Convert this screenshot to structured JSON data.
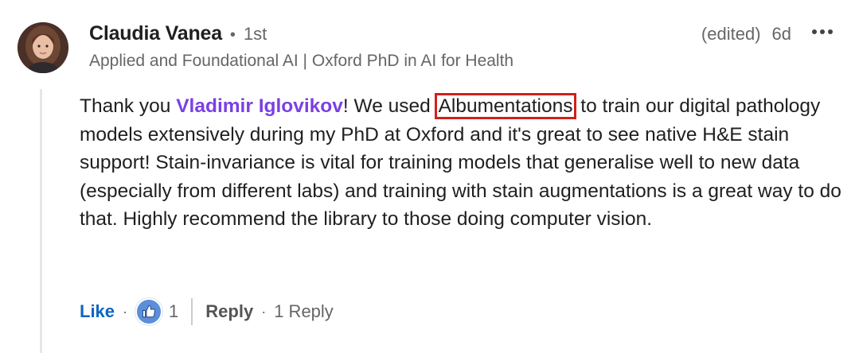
{
  "comment": {
    "author": {
      "name": "Claudia Vanea",
      "degree": "1st",
      "headline": "Applied and Foundational AI | Oxford PhD in AI for Health"
    },
    "edited_label": "(edited)",
    "time": "6d",
    "more_icon": "ellipsis-icon",
    "body": {
      "before_mention": "Thank you ",
      "mention": "Vladimir Iglovikov",
      "after_mention": "! We used ",
      "highlight": "Albumentations",
      "rest": " to train our digital pathology models extensively during my PhD at Oxford and it's great to see native H&E stain support! Stain-invariance is vital for training models that generalise well to new data (especially from different labs) and training with stain augmentations is a great way to do that. Highly recommend the library to those doing computer vision."
    },
    "actions": {
      "like_label": "Like",
      "reaction_icon": "thumbs-up-icon",
      "reaction_count": "1",
      "reply_label": "Reply",
      "reply_count_label": "1 Reply"
    }
  },
  "colors": {
    "mention": "#7b3fe4",
    "like": "#0a66c2",
    "highlight_box": "#d0201c",
    "muted": "#666666"
  }
}
